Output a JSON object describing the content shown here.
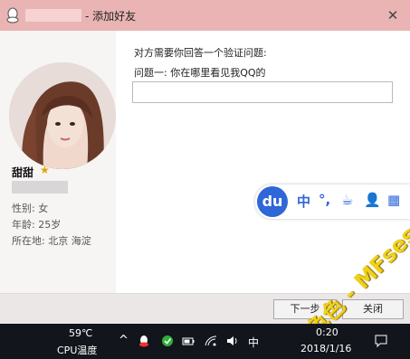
{
  "window": {
    "title": "- 添加好友",
    "close_symbol": "✕"
  },
  "profile": {
    "nickname": "甜甜",
    "star_symbol": "★",
    "gender": "性别: 女",
    "age": "年龄: 25岁",
    "location": "所在地: 北京  海淀"
  },
  "question": {
    "prompt": "对方需要你回答一个验证问题:",
    "label": "问题一: 你在哪里看见我QQ的",
    "answer": ""
  },
  "ime": {
    "logo": "du",
    "items": [
      "中",
      "°,",
      "☕",
      "👤",
      "▦"
    ]
  },
  "buttons": {
    "next": "下一步",
    "close": "关闭"
  },
  "watermark": {
    "text": "免费色色 - MFsese.com"
  },
  "taskbar": {
    "cpu_temp": "59℃",
    "cpu_label": "CPU温度",
    "ime_indicator": "中",
    "time": "0:20",
    "date": "2018/1/16"
  }
}
